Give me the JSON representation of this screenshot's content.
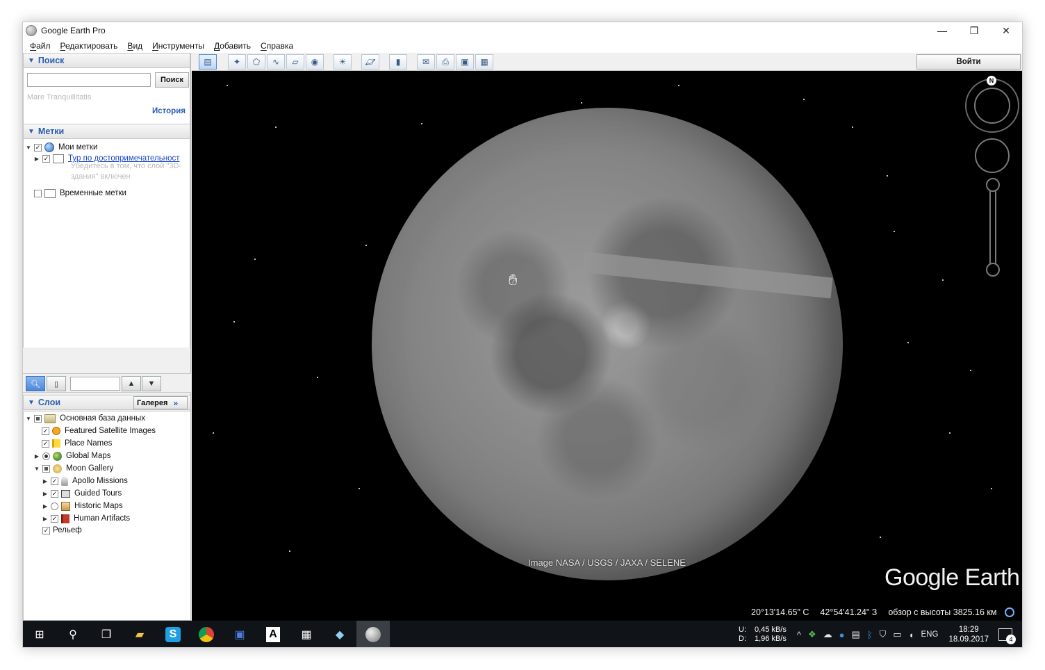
{
  "window": {
    "title": "Google Earth Pro",
    "controls": {
      "minimize": "—",
      "maximize": "❐",
      "close": "✕"
    }
  },
  "menu": [
    "Файл",
    "Редактировать",
    "Вид",
    "Инструменты",
    "Добавить",
    "Справка"
  ],
  "search": {
    "header": "Поиск",
    "input_value": "",
    "button": "Поиск",
    "hint": "Mare Tranquillitatis",
    "history": "История"
  },
  "places": {
    "header": "Метки",
    "my_places": "Мои метки",
    "tour_link": "Тур по достопримечательност",
    "tour_desc": "Убедитесь в том, что слой \"3D-здания\" включен",
    "temp_places": "Временные метки"
  },
  "layers": {
    "header": "Слои",
    "gallery_button": "Галерея",
    "primary_db": "Основная база данных",
    "items": [
      {
        "label": "Featured Satellite Images",
        "checked": true,
        "icon": "satellite-icon"
      },
      {
        "label": "Place Names",
        "checked": true,
        "icon": "flag-icon"
      },
      {
        "label": "Global Maps",
        "checked": true,
        "icon": "globe-icon"
      },
      {
        "label": "Moon Gallery",
        "checked": "partial",
        "icon": "gallery-icon"
      },
      {
        "label": "Apollo Missions",
        "checked": true,
        "icon": "rocket-icon"
      },
      {
        "label": "Guided Tours",
        "checked": true,
        "icon": "tour-icon"
      },
      {
        "label": "Historic Maps",
        "checked": false,
        "icon": "map-icon"
      },
      {
        "label": "Human Artifacts",
        "checked": true,
        "icon": "artifact-flag-icon"
      }
    ],
    "terrain": "Рельеф"
  },
  "toolbar": {
    "login": "Войти"
  },
  "map": {
    "credit": "Image NASA / USGS / JAXA / SELENE",
    "brand": "Google Earth",
    "compass_north": "N",
    "lat": "20°13'14.65\" С",
    "lon": "42°54'41.24\" З",
    "altitude": "обзор с высоты 3825.16 км"
  },
  "taskbar": {
    "net_labels": [
      "U:",
      "D:"
    ],
    "net_values": [
      "0,45 kB/s",
      "1,96 kB/s"
    ],
    "language": "ENG",
    "time": "18:29",
    "date": "18.09.2017",
    "notifications": "4"
  }
}
